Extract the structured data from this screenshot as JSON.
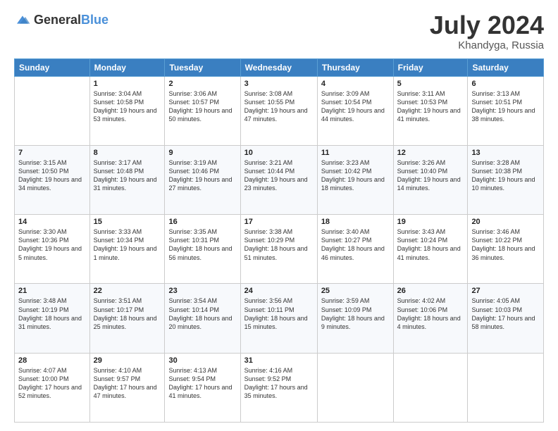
{
  "header": {
    "logo_general": "General",
    "logo_blue": "Blue",
    "month": "July 2024",
    "location": "Khandyga, Russia"
  },
  "weekdays": [
    "Sunday",
    "Monday",
    "Tuesday",
    "Wednesday",
    "Thursday",
    "Friday",
    "Saturday"
  ],
  "weeks": [
    [
      {
        "day": "",
        "sunrise": "",
        "sunset": "",
        "daylight": ""
      },
      {
        "day": "1",
        "sunrise": "Sunrise: 3:04 AM",
        "sunset": "Sunset: 10:58 PM",
        "daylight": "Daylight: 19 hours and 53 minutes."
      },
      {
        "day": "2",
        "sunrise": "Sunrise: 3:06 AM",
        "sunset": "Sunset: 10:57 PM",
        "daylight": "Daylight: 19 hours and 50 minutes."
      },
      {
        "day": "3",
        "sunrise": "Sunrise: 3:08 AM",
        "sunset": "Sunset: 10:55 PM",
        "daylight": "Daylight: 19 hours and 47 minutes."
      },
      {
        "day": "4",
        "sunrise": "Sunrise: 3:09 AM",
        "sunset": "Sunset: 10:54 PM",
        "daylight": "Daylight: 19 hours and 44 minutes."
      },
      {
        "day": "5",
        "sunrise": "Sunrise: 3:11 AM",
        "sunset": "Sunset: 10:53 PM",
        "daylight": "Daylight: 19 hours and 41 minutes."
      },
      {
        "day": "6",
        "sunrise": "Sunrise: 3:13 AM",
        "sunset": "Sunset: 10:51 PM",
        "daylight": "Daylight: 19 hours and 38 minutes."
      }
    ],
    [
      {
        "day": "7",
        "sunrise": "Sunrise: 3:15 AM",
        "sunset": "Sunset: 10:50 PM",
        "daylight": "Daylight: 19 hours and 34 minutes."
      },
      {
        "day": "8",
        "sunrise": "Sunrise: 3:17 AM",
        "sunset": "Sunset: 10:48 PM",
        "daylight": "Daylight: 19 hours and 31 minutes."
      },
      {
        "day": "9",
        "sunrise": "Sunrise: 3:19 AM",
        "sunset": "Sunset: 10:46 PM",
        "daylight": "Daylight: 19 hours and 27 minutes."
      },
      {
        "day": "10",
        "sunrise": "Sunrise: 3:21 AM",
        "sunset": "Sunset: 10:44 PM",
        "daylight": "Daylight: 19 hours and 23 minutes."
      },
      {
        "day": "11",
        "sunrise": "Sunrise: 3:23 AM",
        "sunset": "Sunset: 10:42 PM",
        "daylight": "Daylight: 19 hours and 18 minutes."
      },
      {
        "day": "12",
        "sunrise": "Sunrise: 3:26 AM",
        "sunset": "Sunset: 10:40 PM",
        "daylight": "Daylight: 19 hours and 14 minutes."
      },
      {
        "day": "13",
        "sunrise": "Sunrise: 3:28 AM",
        "sunset": "Sunset: 10:38 PM",
        "daylight": "Daylight: 19 hours and 10 minutes."
      }
    ],
    [
      {
        "day": "14",
        "sunrise": "Sunrise: 3:30 AM",
        "sunset": "Sunset: 10:36 PM",
        "daylight": "Daylight: 19 hours and 5 minutes."
      },
      {
        "day": "15",
        "sunrise": "Sunrise: 3:33 AM",
        "sunset": "Sunset: 10:34 PM",
        "daylight": "Daylight: 19 hours and 1 minute."
      },
      {
        "day": "16",
        "sunrise": "Sunrise: 3:35 AM",
        "sunset": "Sunset: 10:31 PM",
        "daylight": "Daylight: 18 hours and 56 minutes."
      },
      {
        "day": "17",
        "sunrise": "Sunrise: 3:38 AM",
        "sunset": "Sunset: 10:29 PM",
        "daylight": "Daylight: 18 hours and 51 minutes."
      },
      {
        "day": "18",
        "sunrise": "Sunrise: 3:40 AM",
        "sunset": "Sunset: 10:27 PM",
        "daylight": "Daylight: 18 hours and 46 minutes."
      },
      {
        "day": "19",
        "sunrise": "Sunrise: 3:43 AM",
        "sunset": "Sunset: 10:24 PM",
        "daylight": "Daylight: 18 hours and 41 minutes."
      },
      {
        "day": "20",
        "sunrise": "Sunrise: 3:46 AM",
        "sunset": "Sunset: 10:22 PM",
        "daylight": "Daylight: 18 hours and 36 minutes."
      }
    ],
    [
      {
        "day": "21",
        "sunrise": "Sunrise: 3:48 AM",
        "sunset": "Sunset: 10:19 PM",
        "daylight": "Daylight: 18 hours and 31 minutes."
      },
      {
        "day": "22",
        "sunrise": "Sunrise: 3:51 AM",
        "sunset": "Sunset: 10:17 PM",
        "daylight": "Daylight: 18 hours and 25 minutes."
      },
      {
        "day": "23",
        "sunrise": "Sunrise: 3:54 AM",
        "sunset": "Sunset: 10:14 PM",
        "daylight": "Daylight: 18 hours and 20 minutes."
      },
      {
        "day": "24",
        "sunrise": "Sunrise: 3:56 AM",
        "sunset": "Sunset: 10:11 PM",
        "daylight": "Daylight: 18 hours and 15 minutes."
      },
      {
        "day": "25",
        "sunrise": "Sunrise: 3:59 AM",
        "sunset": "Sunset: 10:09 PM",
        "daylight": "Daylight: 18 hours and 9 minutes."
      },
      {
        "day": "26",
        "sunrise": "Sunrise: 4:02 AM",
        "sunset": "Sunset: 10:06 PM",
        "daylight": "Daylight: 18 hours and 4 minutes."
      },
      {
        "day": "27",
        "sunrise": "Sunrise: 4:05 AM",
        "sunset": "Sunset: 10:03 PM",
        "daylight": "Daylight: 17 hours and 58 minutes."
      }
    ],
    [
      {
        "day": "28",
        "sunrise": "Sunrise: 4:07 AM",
        "sunset": "Sunset: 10:00 PM",
        "daylight": "Daylight: 17 hours and 52 minutes."
      },
      {
        "day": "29",
        "sunrise": "Sunrise: 4:10 AM",
        "sunset": "Sunset: 9:57 PM",
        "daylight": "Daylight: 17 hours and 47 minutes."
      },
      {
        "day": "30",
        "sunrise": "Sunrise: 4:13 AM",
        "sunset": "Sunset: 9:54 PM",
        "daylight": "Daylight: 17 hours and 41 minutes."
      },
      {
        "day": "31",
        "sunrise": "Sunrise: 4:16 AM",
        "sunset": "Sunset: 9:52 PM",
        "daylight": "Daylight: 17 hours and 35 minutes."
      },
      {
        "day": "",
        "sunrise": "",
        "sunset": "",
        "daylight": ""
      },
      {
        "day": "",
        "sunrise": "",
        "sunset": "",
        "daylight": ""
      },
      {
        "day": "",
        "sunrise": "",
        "sunset": "",
        "daylight": ""
      }
    ]
  ]
}
